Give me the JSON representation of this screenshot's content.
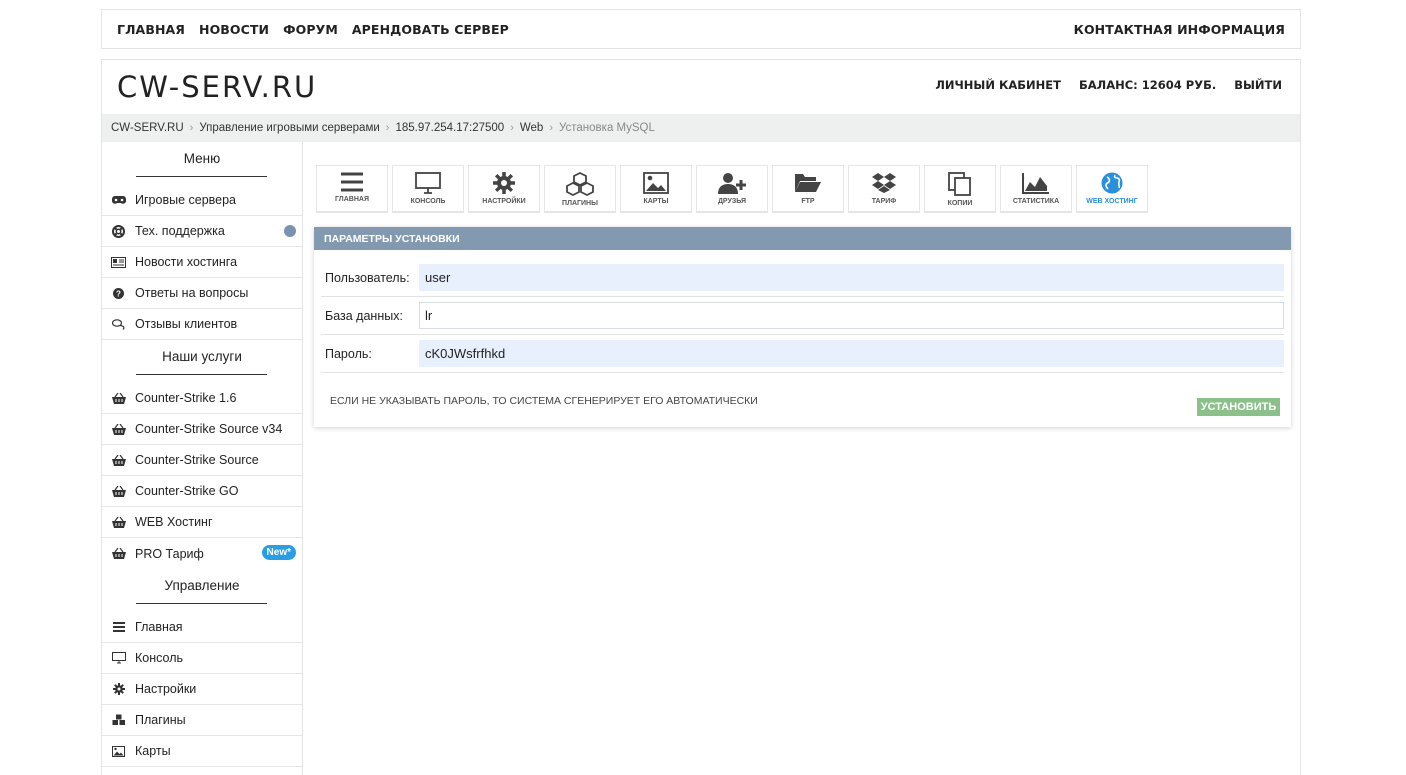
{
  "topnav": {
    "links": [
      "ГЛАВНАЯ",
      "НОВОСТИ",
      "ФОРУМ",
      "АРЕНДОВАТЬ СЕРВЕР"
    ],
    "contact": "КОНТАКТНАЯ ИНФОРМАЦИЯ"
  },
  "header": {
    "logo": "CW-SERV.RU",
    "account": "ЛИЧНЫЙ КАБИНЕТ",
    "balance": "БАЛАНС: 12604 РУБ.",
    "logout": "ВЫЙТИ"
  },
  "breadcrumb": [
    "CW-SERV.RU",
    "Управление игровыми серверами",
    "185.97.254.17:27500",
    "Web",
    "Установка MySQL"
  ],
  "sidebar": {
    "menu_title": "Меню",
    "menu_items": [
      {
        "label": "Игровые сервера",
        "icon": "gamepad-icon"
      },
      {
        "label": "Тех. поддержка",
        "icon": "lifebuoy-icon"
      },
      {
        "label": "Новости хостинга",
        "icon": "newspaper-icon"
      },
      {
        "label": "Ответы на вопросы",
        "icon": "question-icon"
      },
      {
        "label": "Отзывы клиентов",
        "icon": "comments-icon"
      }
    ],
    "services_title": "Наши услуги",
    "services_items": [
      {
        "label": "Counter-Strike 1.6",
        "icon": "basket-icon"
      },
      {
        "label": "Counter-Strike Source v34",
        "icon": "basket-icon"
      },
      {
        "label": "Counter-Strike Source",
        "icon": "basket-icon"
      },
      {
        "label": "Counter-Strike GO",
        "icon": "basket-icon"
      },
      {
        "label": "WEB Хостинг",
        "icon": "basket-icon"
      },
      {
        "label": "PRO Тариф",
        "icon": "basket-icon",
        "badge": "New*"
      }
    ],
    "manage_title": "Управление",
    "manage_items": [
      {
        "label": "Главная",
        "icon": "bars-icon"
      },
      {
        "label": "Консоль",
        "icon": "monitor-icon"
      },
      {
        "label": "Настройки",
        "icon": "gear-icon"
      },
      {
        "label": "Плагины",
        "icon": "cubes-icon"
      },
      {
        "label": "Карты",
        "icon": "image-icon"
      }
    ]
  },
  "toolbar": [
    {
      "label": "ГЛАВНАЯ",
      "icon": "bars-icon"
    },
    {
      "label": "КОНСОЛЬ",
      "icon": "monitor-icon"
    },
    {
      "label": "НАСТРОЙКИ",
      "icon": "gear-icon"
    },
    {
      "label": "ПЛАГИНЫ",
      "icon": "cubes-icon"
    },
    {
      "label": "КАРТЫ",
      "icon": "image-icon"
    },
    {
      "label": "ДРУЗЬЯ",
      "icon": "user-plus-icon"
    },
    {
      "label": "FTP",
      "icon": "folder-open-icon"
    },
    {
      "label": "ТАРИФ",
      "icon": "dropbox-icon"
    },
    {
      "label": "КОПИИ",
      "icon": "copy-icon"
    },
    {
      "label": "СТАТИСТИКА",
      "icon": "area-chart-icon"
    },
    {
      "label": "WEB ХОСТИНГ",
      "icon": "globe-icon",
      "active": true
    }
  ],
  "panel": {
    "title": "ПАРАМЕТРЫ УСТАНОВКИ",
    "user_label": "Пользователь:",
    "user_value": "user",
    "db_label": "База данных:",
    "db_value": "lr",
    "password_label": "Пароль:",
    "password_value": "cK0JWsfrfhkd",
    "note": "ЕСЛИ НЕ УКАЗЫВАТЬ ПАРОЛЬ, ТО СИСТЕМА СГЕНЕРИРУЕТ ЕГО АВТОМАТИЧЕСКИ",
    "install_label": "УСТАНОВИТЬ"
  },
  "colors": {
    "panel_header": "#8399b0",
    "install_button": "#8bc08b",
    "badge": "#2a9ee5",
    "active_tab": "#2a8fdc",
    "filled_input": "#e8f0fd"
  }
}
